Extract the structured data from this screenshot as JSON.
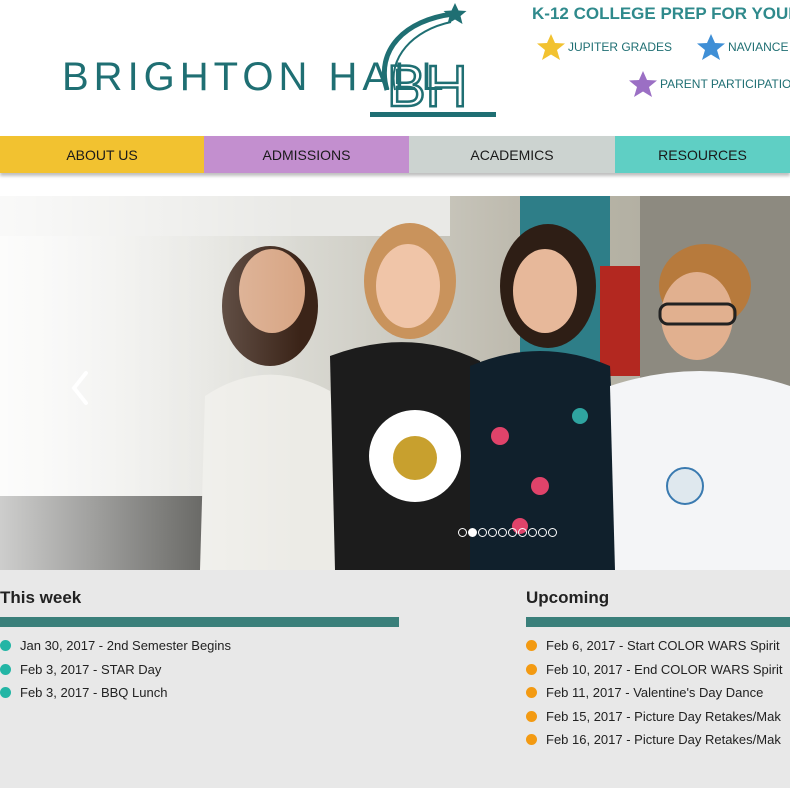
{
  "header": {
    "logo_text": "BRIGHTON HALL",
    "logo_monogram": "BH",
    "tagline": "K-12 COLLEGE PREP FOR YOUN",
    "links": [
      {
        "label": "JUPITER GRADES",
        "icon": "star-yellow-icon",
        "color": "#f2c230"
      },
      {
        "label": "NAVIANCE",
        "icon": "star-blue-icon",
        "color": "#3f8fd6"
      },
      {
        "label": "PARENT PARTICIPATION",
        "icon": "star-purple-icon",
        "color": "#9b6fc4"
      }
    ]
  },
  "nav": [
    {
      "label": "ABOUT US",
      "color": "#f2c230"
    },
    {
      "label": "ADMISSIONS",
      "color": "#c38fcf"
    },
    {
      "label": "ACADEMICS",
      "color": "#ccd3d0"
    },
    {
      "label": "RESOURCES",
      "color": "#5fcfc4"
    }
  ],
  "slider": {
    "prev_icon": "chevron-left-icon",
    "dot_count": 10,
    "active_dot": 2
  },
  "this_week": {
    "title": "This week",
    "bullet_color": "#23b5a5",
    "items": [
      "Jan 30, 2017 - 2nd Semester Begins",
      "Feb 3, 2017 - STAR Day",
      "Feb 3, 2017 - BBQ Lunch"
    ]
  },
  "upcoming": {
    "title": "Upcoming",
    "bullet_color": "#f39a12",
    "items": [
      "Feb 6, 2017 - Start COLOR WARS Spirit",
      "Feb 10, 2017 - End COLOR WARS Spirit",
      "Feb 11, 2017 - Valentine's Day Dance",
      "Feb 15, 2017 - Picture Day Retakes/Mak",
      "Feb 16, 2017 - Picture Day Retakes/Mak"
    ]
  }
}
